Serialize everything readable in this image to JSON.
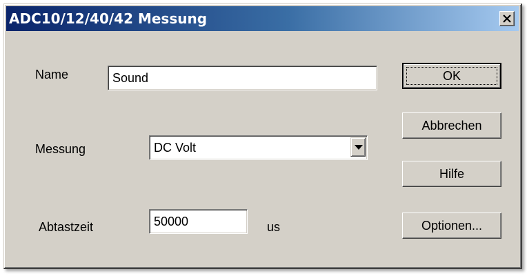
{
  "window": {
    "title": "ADC10/12/40/42 Messung"
  },
  "form": {
    "name_label": "Name",
    "name_value": "Sound",
    "messung_label": "Messung",
    "messung_value": "DC Volt",
    "abtastzeit_label": "Abtastzeit",
    "abtastzeit_value": "50000",
    "abtastzeit_unit": "us"
  },
  "buttons": {
    "ok": "OK",
    "abbrechen": "Abbrechen",
    "hilfe": "Hilfe",
    "optionen": "Optionen..."
  },
  "icons": {
    "close": "close-icon",
    "dropdown": "chevron-down-icon"
  },
  "colors": {
    "titlebar_start": "#0a246a",
    "titlebar_end": "#a6caf0",
    "dialog_face": "#d4d0c8"
  }
}
